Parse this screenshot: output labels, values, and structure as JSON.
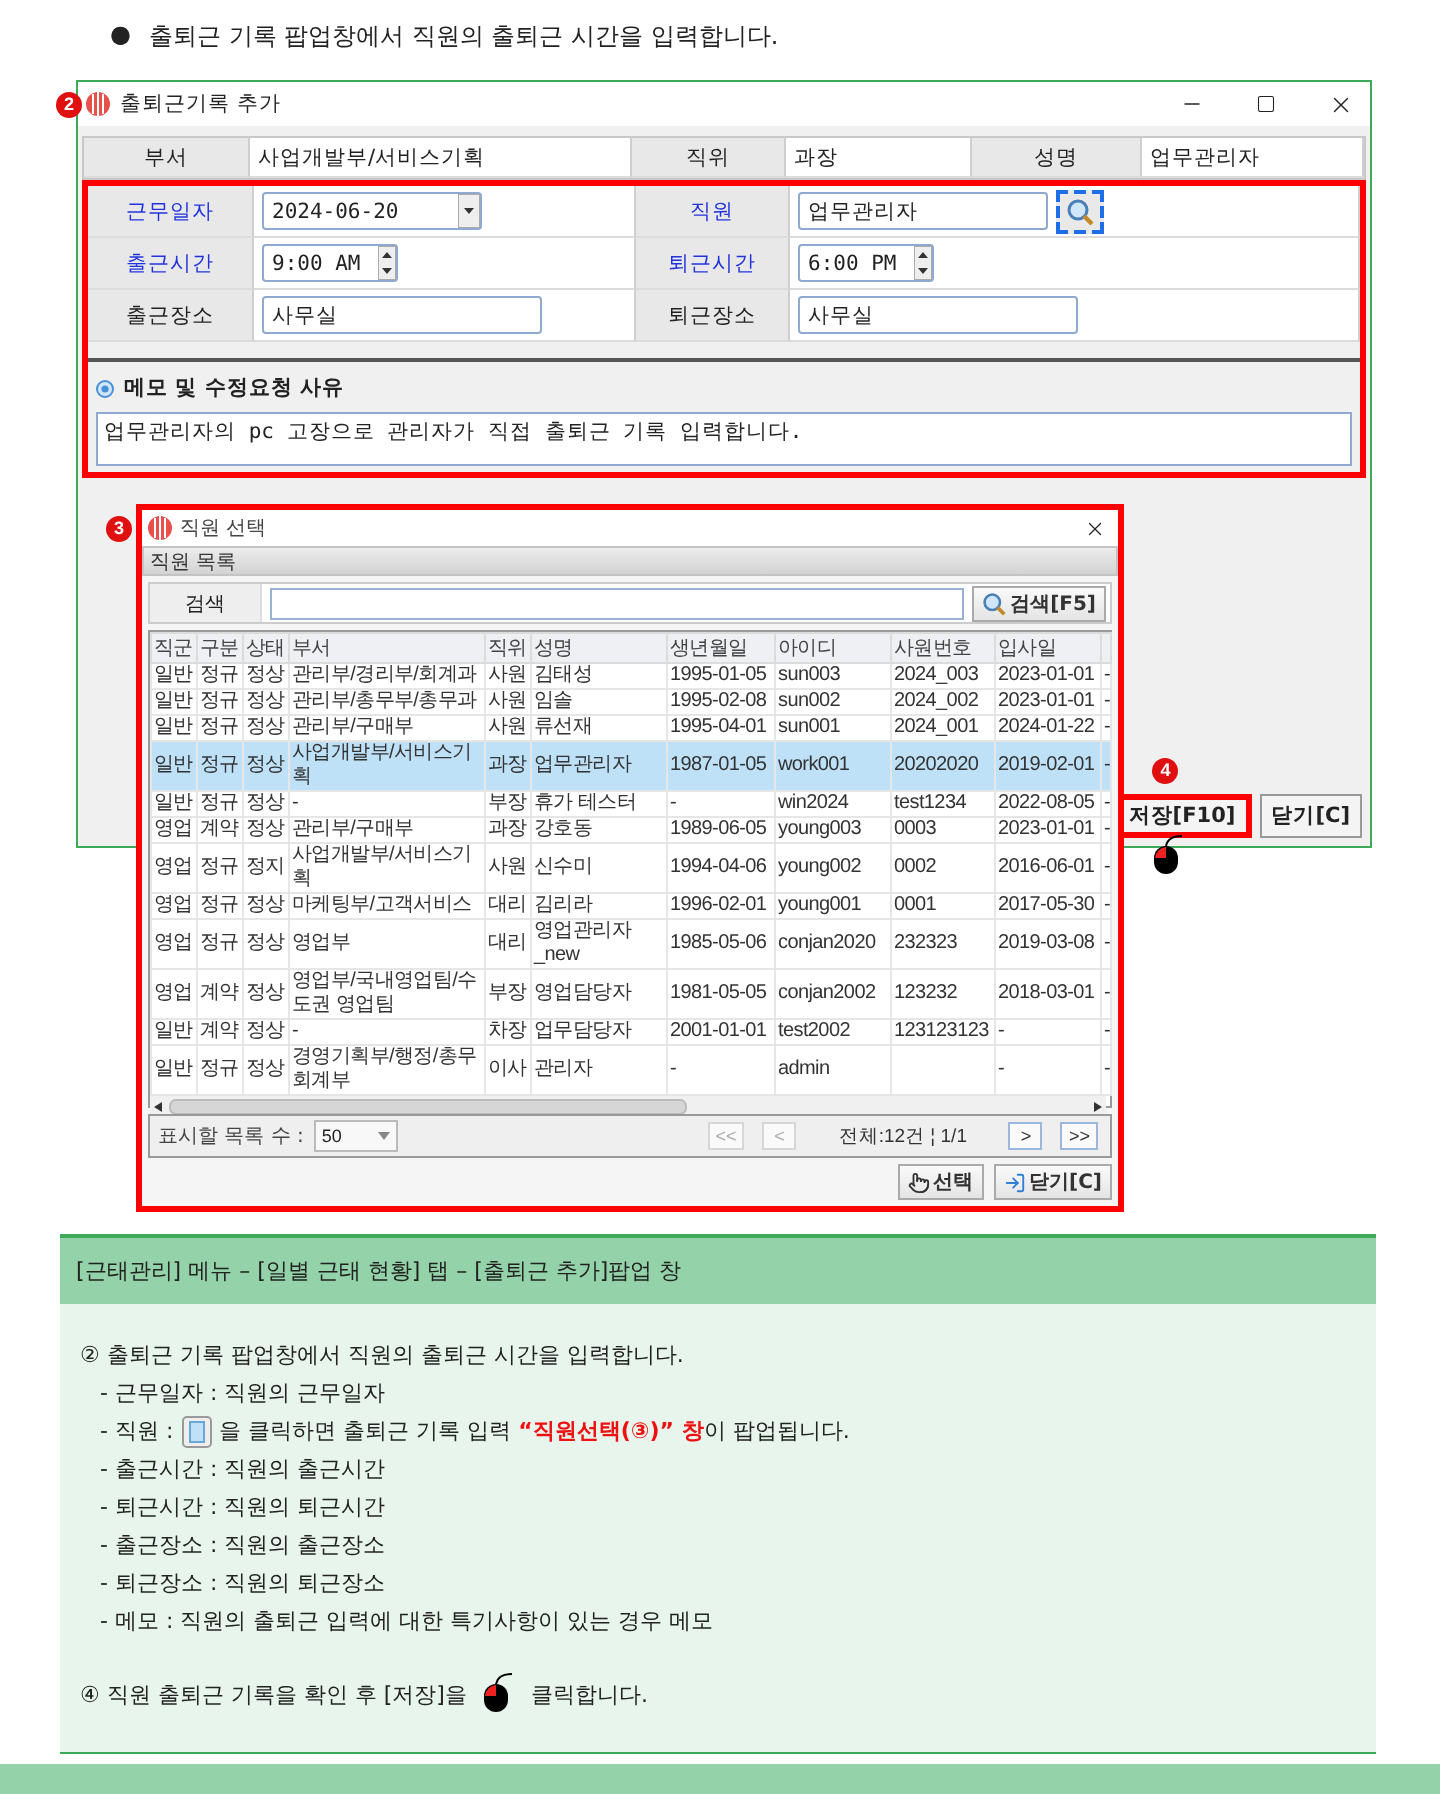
{
  "intro": {
    "bullet": "●",
    "text": "출퇴근 기록 팝업창에서 직원의 출퇴근 시간을 입력합니다."
  },
  "attendance_dialog": {
    "marker": "2",
    "title": "출퇴근기록 추가",
    "header": [
      {
        "label": "부서",
        "value": "사업개발부/서비스기획"
      },
      {
        "label": "직위",
        "value": "과장"
      },
      {
        "label": "성명",
        "value": "업무관리자"
      }
    ],
    "form": {
      "highlighted": true,
      "rows": [
        [
          {
            "label": "근무일자",
            "required": true,
            "kind": "date",
            "value": "2024-06-20"
          },
          {
            "label": "직원",
            "required": true,
            "kind": "lookup",
            "value": "업무관리자",
            "button_highlighted": true
          }
        ],
        [
          {
            "label": "출근시간",
            "required": true,
            "kind": "time",
            "value": "9:00 AM"
          },
          {
            "label": "퇴근시간",
            "required": true,
            "kind": "time",
            "value": "6:00 PM"
          }
        ],
        [
          {
            "label": "출근장소",
            "required": false,
            "kind": "text",
            "value": "사무실"
          },
          {
            "label": "퇴근장소",
            "required": false,
            "kind": "text",
            "value": "사무실"
          }
        ]
      ]
    },
    "memo": {
      "title": "메모 및 수정요청 사유",
      "value": "업무관리자의 pc 고장으로 관리자가 직접 출퇴근 기록 입력합니다."
    },
    "buttons": [
      {
        "label": "저장[F10]",
        "highlighted": true,
        "marker": "4",
        "pointer": true
      },
      {
        "label": "닫기[C]",
        "highlighted": false,
        "pointer": false
      }
    ]
  },
  "employee_dialog": {
    "marker": "3",
    "highlighted": true,
    "title": "직원 선택",
    "group_title": "직원 목록",
    "search": {
      "label": "검색",
      "button": "검색[F5]"
    },
    "columns": [
      "직군",
      "구분",
      "상태",
      "부서",
      "직위",
      "성명",
      "생년월일",
      "아이디",
      "사원번호",
      "입사일"
    ],
    "rows": [
      {
        "selected": false,
        "cells": [
          "일반",
          "정규",
          "정상",
          "관리부/경리부/회계과",
          "사원",
          "김태성",
          "1995-01-05",
          "sun003",
          "2024_003",
          "2023-01-01",
          "-"
        ]
      },
      {
        "selected": false,
        "cells": [
          "일반",
          "정규",
          "정상",
          "관리부/총무부/총무과",
          "사원",
          "임솔",
          "1995-02-08",
          "sun002",
          "2024_002",
          "2023-01-01",
          "-"
        ]
      },
      {
        "selected": false,
        "cells": [
          "일반",
          "정규",
          "정상",
          "관리부/구매부",
          "사원",
          "류선재",
          "1995-04-01",
          "sun001",
          "2024_001",
          "2024-01-22",
          "-"
        ]
      },
      {
        "selected": true,
        "cells": [
          "일반",
          "정규",
          "정상",
          "사업개발부/서비스기획",
          "과장",
          "업무관리자",
          "1987-01-05",
          "work001",
          "20202020",
          "2019-02-01",
          "-"
        ]
      },
      {
        "selected": false,
        "cells": [
          "일반",
          "정규",
          "정상",
          "-",
          "부장",
          "휴가 테스터",
          "-",
          "win2024",
          "test1234",
          "2022-08-05",
          "-"
        ]
      },
      {
        "selected": false,
        "cells": [
          "영업",
          "계약",
          "정상",
          "관리부/구매부",
          "과장",
          "강호동",
          "1989-06-05",
          "young003",
          "0003",
          "2023-01-01",
          "-"
        ]
      },
      {
        "selected": false,
        "cells": [
          "영업",
          "정규",
          "정지",
          "사업개발부/서비스기획",
          "사원",
          "신수미",
          "1994-04-06",
          "young002",
          "0002",
          "2016-06-01",
          "-"
        ]
      },
      {
        "selected": false,
        "cells": [
          "영업",
          "정규",
          "정상",
          "마케팅부/고객서비스",
          "대리",
          "김리라",
          "1996-02-01",
          "young001",
          "0001",
          "2017-05-30",
          "-"
        ]
      },
      {
        "selected": false,
        "cells": [
          "영업",
          "정규",
          "정상",
          "영업부",
          "대리",
          "영업관리자_new",
          "1985-05-06",
          "conjan2020",
          "232323",
          "2019-03-08",
          "-"
        ]
      },
      {
        "selected": false,
        "cells": [
          "영업",
          "계약",
          "정상",
          "영업부/국내영업팀/수도권 영업팀",
          "부장",
          "영업담당자",
          "1981-05-05",
          "conjan2002",
          "123232",
          "2018-03-01",
          "-"
        ]
      },
      {
        "selected": false,
        "cells": [
          "일반",
          "계약",
          "정상",
          "-",
          "차장",
          "업무담당자",
          "2001-01-01",
          "test2002",
          "123123123",
          "-",
          "-"
        ]
      },
      {
        "selected": false,
        "cells": [
          "일반",
          "정규",
          "정상",
          "경영기획부/행정/총무회계부",
          "이사",
          "관리자",
          "-",
          "admin",
          null,
          "-",
          "-"
        ]
      }
    ],
    "pager": {
      "label": "표시할 목록 수 :",
      "page_size": "50",
      "summary": "전체:12건 ¦ 1/1",
      "before_buttons": [
        {
          "label": "<<",
          "disabled": true
        },
        {
          "label": "<",
          "disabled": true
        }
      ],
      "after_buttons": [
        {
          "label": ">",
          "disabled": false
        },
        {
          "label": ">>",
          "disabled": false
        }
      ]
    },
    "buttons": [
      {
        "label": "선택",
        "kind": "select"
      },
      {
        "label": "닫기[C]",
        "kind": "close"
      }
    ]
  },
  "guide": {
    "header": "[근태관리] 메뉴 – [일별 근태 현황] 탭 – [출퇴근 추가]팝업 창",
    "items": [
      {
        "kind": "text",
        "text": "② 출퇴근 기록 팝업창에서 직원의 출퇴근 시간을 입력합니다.",
        "indent": false
      },
      {
        "kind": "text",
        "text": "- 근무일자 : 직원의 근무일자",
        "indent": true
      },
      {
        "kind": "button-icon",
        "before": "- 직원 :",
        "after": "을 클릭하면  출퇴근 기록 입력 **“직원선택(③)” 창**이 팝업됩니다.",
        "indent": true
      },
      {
        "kind": "text",
        "text": "- 출근시간 : 직원의 출근시간",
        "indent": true
      },
      {
        "kind": "text",
        "text": "- 퇴근시간 : 직원의 퇴근시간",
        "indent": true
      },
      {
        "kind": "text",
        "text": "- 출근장소 : 직원의 출근장소",
        "indent": true
      },
      {
        "kind": "text",
        "text": "- 퇴근장소 : 직원의 퇴근장소",
        "indent": true
      },
      {
        "kind": "text",
        "text": "- 메모 : 직원의 출퇴근 입력에 대한 특기사항이 있는 경우 메모",
        "indent": true
      },
      {
        "kind": "mouse-icon",
        "before": "④ 직원 출퇴근 기록을 확인 후 [저장]을",
        "after": "클릭합니다.",
        "indent": false
      }
    ]
  }
}
